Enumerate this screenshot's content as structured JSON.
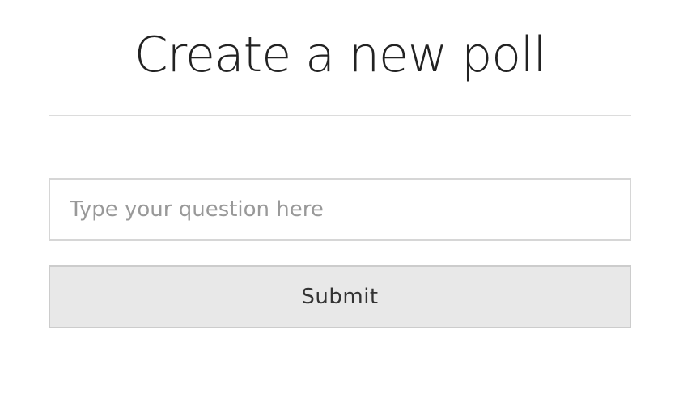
{
  "header": {
    "title": "Create a new poll"
  },
  "form": {
    "question_value": "",
    "question_placeholder": "Type your question here",
    "submit_label": "Submit"
  },
  "colors": {
    "background": "#ffffff",
    "title_text": "#222222",
    "divider": "#dcdcdc",
    "input_border": "#d6d6d6",
    "placeholder_text": "#999999",
    "button_background": "#e8e8e8",
    "button_border": "#cccccc",
    "button_text": "#333333"
  }
}
